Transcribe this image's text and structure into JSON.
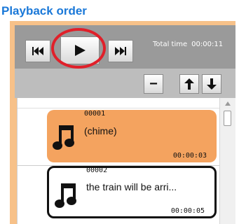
{
  "panel": {
    "title": "Playback order"
  },
  "toolbar": {
    "total_label": "Total time",
    "total_value": "00:00:11",
    "icons": {
      "previous": "skip-previous-icon",
      "play": "play-icon",
      "next": "skip-next-icon"
    }
  },
  "list_toolbar": {
    "remove_label": "−",
    "icons": {
      "up": "arrow-up-icon",
      "down": "arrow-down-icon"
    }
  },
  "tracks": [
    {
      "number": "00001",
      "title": "(chime)",
      "duration": "00:00:03",
      "state": "playing",
      "icon": "music-note-icon"
    },
    {
      "number": "00002",
      "title": "the train will be arri...",
      "duration": "00:00:05",
      "state": "selected",
      "icon": "music-note-icon"
    }
  ],
  "colors": {
    "title": "#1a78d8",
    "frame": "#f7c189",
    "playing_card": "#f4a35f",
    "highlight_ring": "#e0202a"
  }
}
